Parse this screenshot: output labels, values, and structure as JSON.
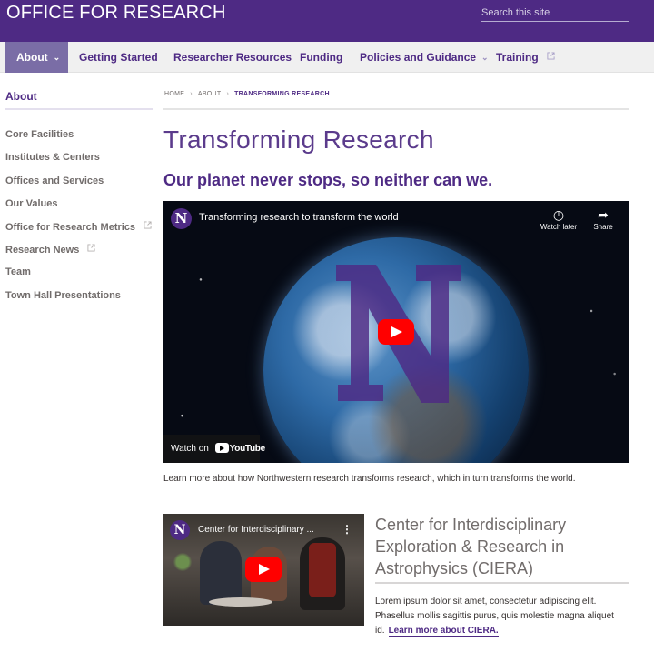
{
  "header": {
    "site_title": "OFFICE FOR RESEARCH",
    "search_placeholder": "Search this site",
    "background": "#4e2a84"
  },
  "nav": {
    "items": [
      {
        "label": "About",
        "active": true,
        "has_dropdown": true
      },
      {
        "label": "Getting Started"
      },
      {
        "label": "Researcher Resources"
      },
      {
        "label": "Funding"
      },
      {
        "label": "Policies and Guidance",
        "has_dropdown": true
      },
      {
        "label": "Training",
        "external": true
      }
    ]
  },
  "sidebar": {
    "heading": "About",
    "items": [
      {
        "label": "Core Facilities"
      },
      {
        "label": "Institutes & Centers"
      },
      {
        "label": "Offices and Services"
      },
      {
        "label": "Our Values"
      },
      {
        "label": "Office for Research Metrics",
        "external": true
      },
      {
        "label": "Research News",
        "external": true
      },
      {
        "label": "Team"
      },
      {
        "label": "Town Hall Presentations"
      }
    ]
  },
  "breadcrumb": {
    "items": [
      "HOME",
      "ABOUT",
      "TRANSFORMING RESEARCH"
    ]
  },
  "main": {
    "title": "Transforming Research",
    "subtitle": "Our planet never stops, so neither can we.",
    "video1": {
      "badge": "N",
      "title": "Transforming research to transform the world",
      "watch_later": "Watch later",
      "share": "Share",
      "watch_on": "Watch on",
      "youtube": "YouTube"
    },
    "caption": "Learn more about how Northwestern research transforms research, which in turn transforms the world.",
    "video2": {
      "badge": "N",
      "title": "Center for Interdisciplinary ..."
    },
    "ciera": {
      "title": "Center for Interdisciplinary Exploration & Research in Astrophysics (CIERA)",
      "body": "Lorem ipsum dolor sit amet, consectetur adipiscing elit. Phasellus mollis sagittis purus, quis molestie magna aliquet id.",
      "link": "Learn more about CIERA."
    }
  },
  "colors": {
    "brand_purple": "#4e2a84",
    "nav_active": "#7a6da6",
    "youtube_red": "#ff0000"
  }
}
